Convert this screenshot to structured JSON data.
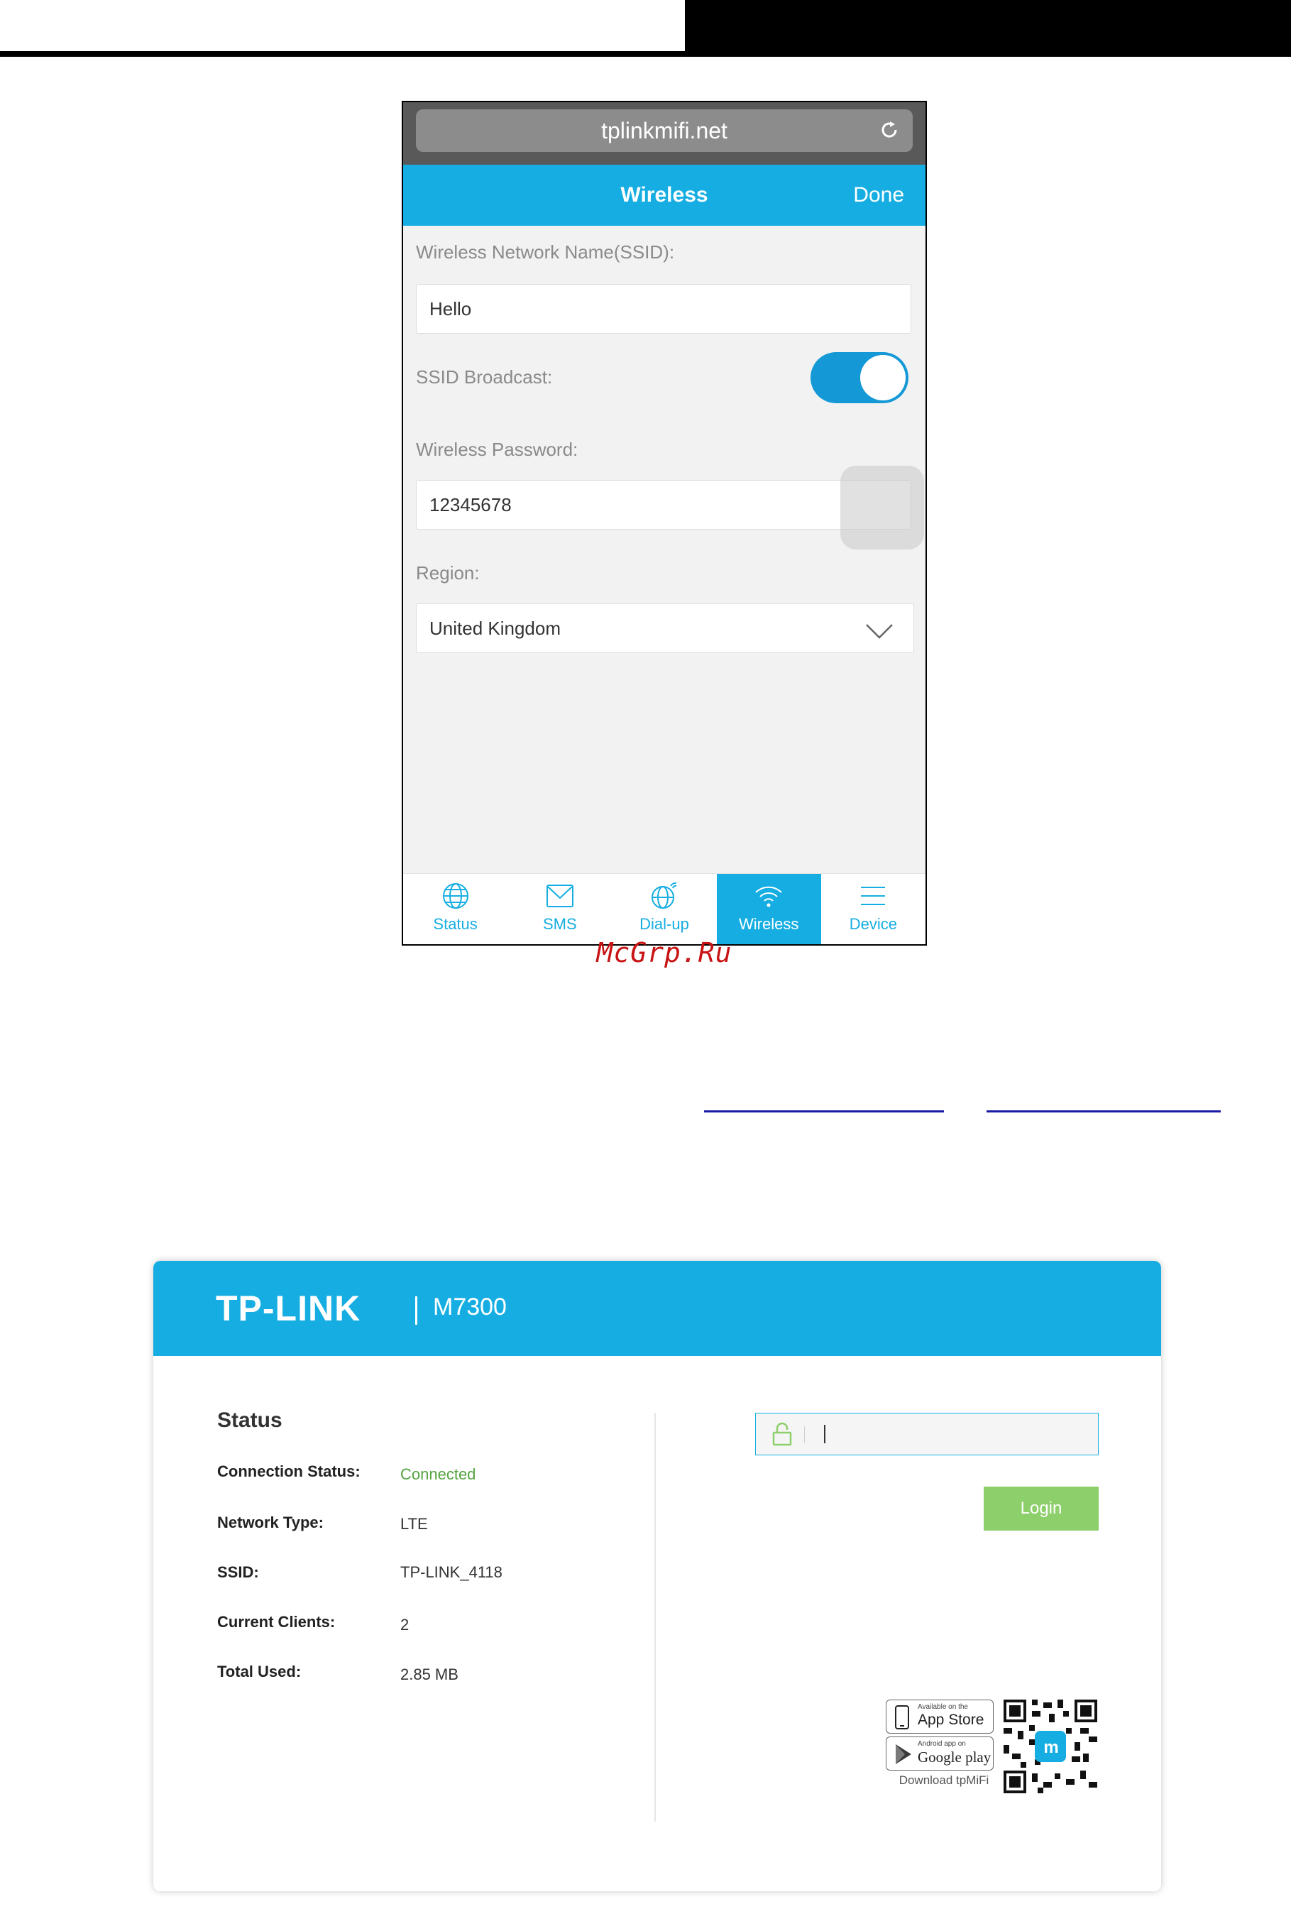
{
  "phone": {
    "url": "tplinkmifi.net",
    "title": "Wireless",
    "done": "Done",
    "ssid_label": "Wireless Network Name(SSID):",
    "ssid_value": "Hello",
    "broadcast_label": "SSID Broadcast:",
    "broadcast_on": true,
    "password_label": "Wireless Password:",
    "password_value": "12345678",
    "region_label": "Region:",
    "region_value": "United Kingdom",
    "tabs": [
      {
        "label": "Status",
        "icon": "globe-icon"
      },
      {
        "label": "SMS",
        "icon": "envelope-icon"
      },
      {
        "label": "Dial-up",
        "icon": "globe-signal-icon"
      },
      {
        "label": "Wireless",
        "icon": "wifi-icon"
      },
      {
        "label": "Device",
        "icon": "menu-icon"
      }
    ],
    "active_tab": "Wireless",
    "accent": "#16aee2"
  },
  "watermark": "McGrp.Ru",
  "panel": {
    "brand": "TP-LINK",
    "model": "M7300",
    "status_title": "Status",
    "rows": [
      {
        "key": "Connection Status:",
        "value": "Connected"
      },
      {
        "key": "Network Type:",
        "value": "LTE"
      },
      {
        "key": "SSID:",
        "value": "TP-LINK_4118"
      },
      {
        "key": "Current Clients:",
        "value": "2"
      },
      {
        "key": "Total Used:",
        "value": "2.85 MB"
      }
    ],
    "login_label": "Login",
    "app_store_small": "Available on the",
    "app_store_big": "App Store",
    "google_small": "Android app on",
    "google_big": "Google play",
    "download_text": "Download tpMiFi",
    "qr_badge": "m",
    "connected_color": "#53a43f",
    "login_color": "#8dcf6b"
  }
}
